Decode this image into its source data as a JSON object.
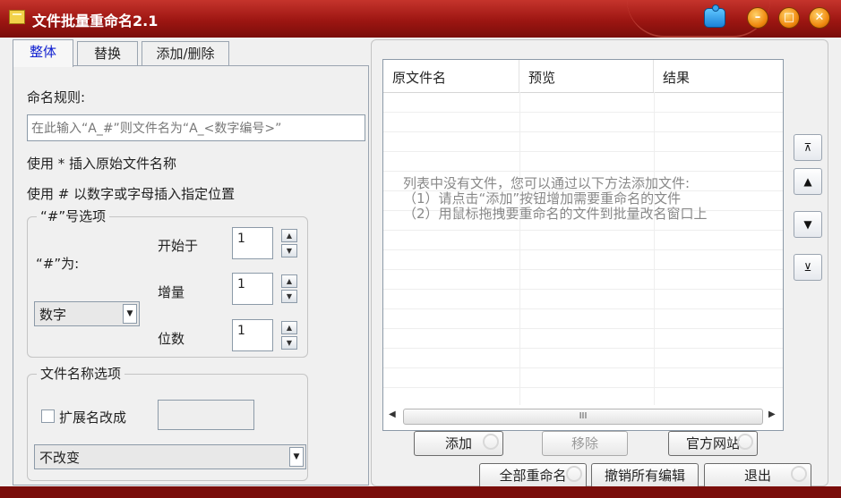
{
  "window": {
    "title": "文件批量重命名2.1"
  },
  "tabs": [
    {
      "label": "整体"
    },
    {
      "label": "替换"
    },
    {
      "label": "添加/删除"
    }
  ],
  "left": {
    "naming_rule_label": "命名规则:",
    "naming_rule_placeholder": "在此输入“A_#”则文件名为“A_<数字编号>”",
    "hint_star": "使用 * 插入原始文件名称",
    "hint_hash": "使用 # 以数字或字母插入指定位置",
    "hash_group_title": "“#”号选项",
    "hash_as_label": "“#”为:",
    "hash_type_value": "数字",
    "start_label": "开始于",
    "start_value": "1",
    "increment_label": "增量",
    "increment_value": "1",
    "digits_label": "位数",
    "digits_value": "1",
    "filename_group_title": "文件名称选项",
    "ext_change_label": "扩展名改成",
    "ext_change_value": "",
    "ext_mode_value": "不改变"
  },
  "list": {
    "columns": [
      "原文件名",
      "预览",
      "结果"
    ],
    "empty_line1": "列表中没有文件，您可以通过以下方法添加文件:",
    "empty_line2": "（1）请点击“添加”按钮增加需要重命名的文件",
    "empty_line3": "（2）用鼠标拖拽要重命名的文件到批量改名窗口上",
    "scroll_thumb": "III"
  },
  "buttons": {
    "add": "添加",
    "remove": "移除",
    "website": "官方网站",
    "rename_all": "全部重命名",
    "undo_all": "撤销所有编辑",
    "exit": "退出"
  },
  "side_buttons": [
    "move-top",
    "move-up",
    "move-down",
    "move-bottom"
  ]
}
